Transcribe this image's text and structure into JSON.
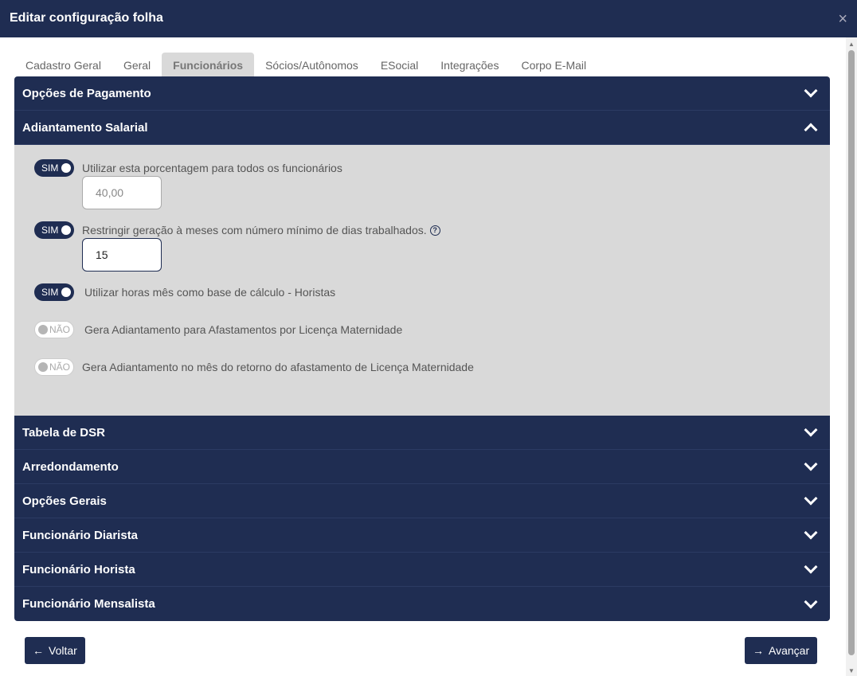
{
  "header": {
    "title": "Editar configuração folha",
    "close": "×"
  },
  "tabs": [
    "Cadastro Geral",
    "Geral",
    "Funcionários",
    "Sócios/Autônomos",
    "ESocial",
    "Integrações",
    "Corpo E-Mail"
  ],
  "sections": {
    "opcoes_pagamento": "Opções de Pagamento",
    "adiantamento": "Adiantamento Salarial",
    "rest": [
      "Tabela de DSR",
      "Arredondamento",
      "Opções Gerais",
      "Funcionário Diarista",
      "Funcionário Horista",
      "Funcionário Mensalista"
    ]
  },
  "options": [
    {
      "state": "SIM",
      "label": "Utilizar esta porcentagem para todos os funcionários",
      "value": "40,00"
    },
    {
      "state": "SIM",
      "label": "Restringir geração à meses com número mínimo de dias trabalhados.",
      "value": "15",
      "help": "?"
    },
    {
      "state": "SIM",
      "label": "Utilizar horas mês como base de cálculo - Horistas"
    },
    {
      "state": "NÃO",
      "label": "Gera Adiantamento para Afastamentos por Licença Maternidade"
    },
    {
      "state": "NÃO",
      "label": "Gera Adiantamento no mês do retorno do afastamento de Licença Maternidade"
    }
  ],
  "buttons": {
    "back": "Voltar",
    "next": "Avançar"
  }
}
